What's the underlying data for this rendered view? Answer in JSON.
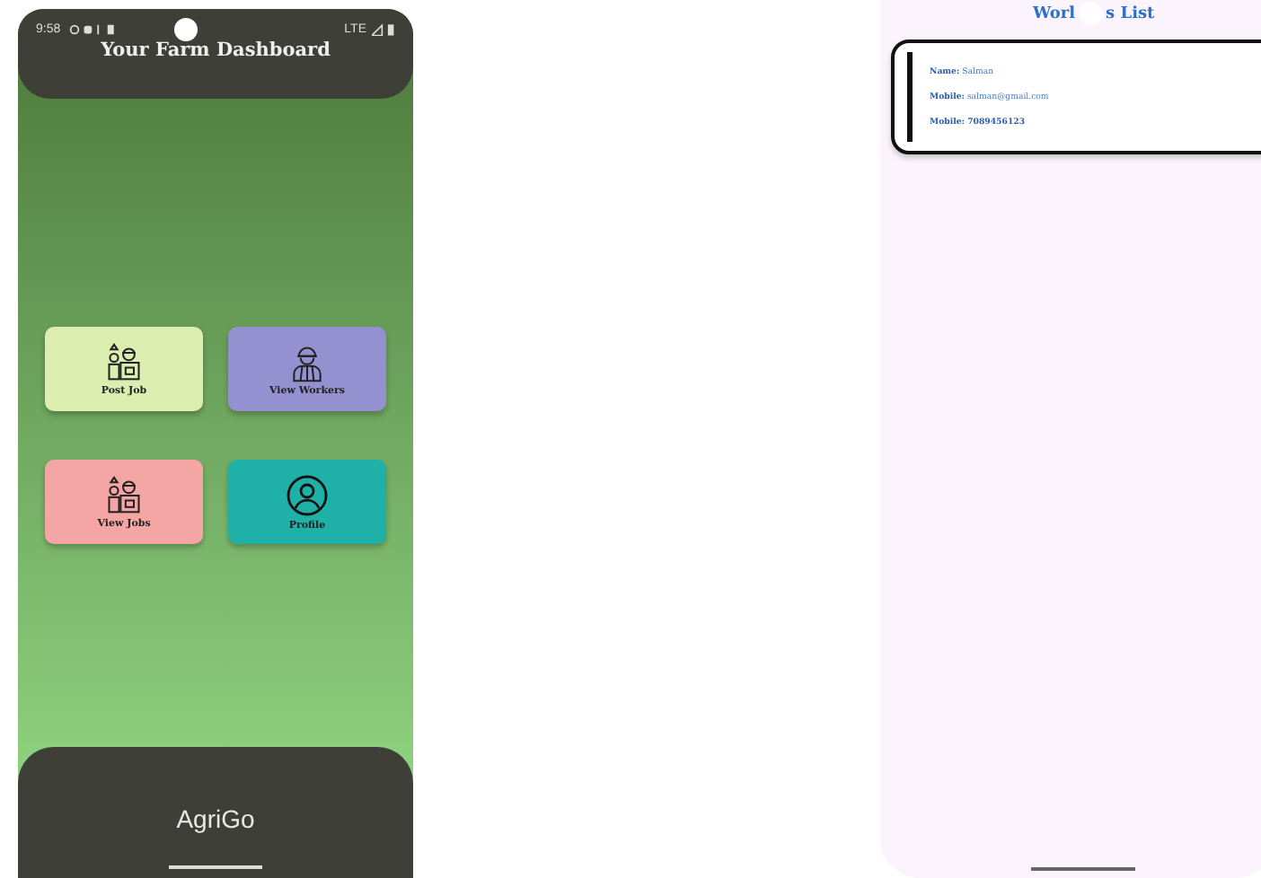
{
  "left_phone": {
    "status_bar": {
      "time": "9:58",
      "network": "LTE"
    },
    "title": "Your Farm Dashboard",
    "tiles": [
      {
        "label": "Post Job",
        "kind": "job",
        "color": "#dbeeb0"
      },
      {
        "label": "View Workers",
        "kind": "worker",
        "color": "#9591d1"
      },
      {
        "label": "View Jobs",
        "kind": "job",
        "color": "#f6a5a5"
      },
      {
        "label": "Profile",
        "kind": "profile",
        "color": "#1fb1a8"
      }
    ],
    "bottom_bar": {
      "title": "AgriGo"
    }
  },
  "right_phone": {
    "title_parts": [
      "Worl",
      "s List"
    ],
    "workers": [
      {
        "lines": [
          "**Name:** Salman",
          "**Mobile:** salman@gmail.com",
          "**Mobile: 7089456123**"
        ]
      }
    ]
  }
}
